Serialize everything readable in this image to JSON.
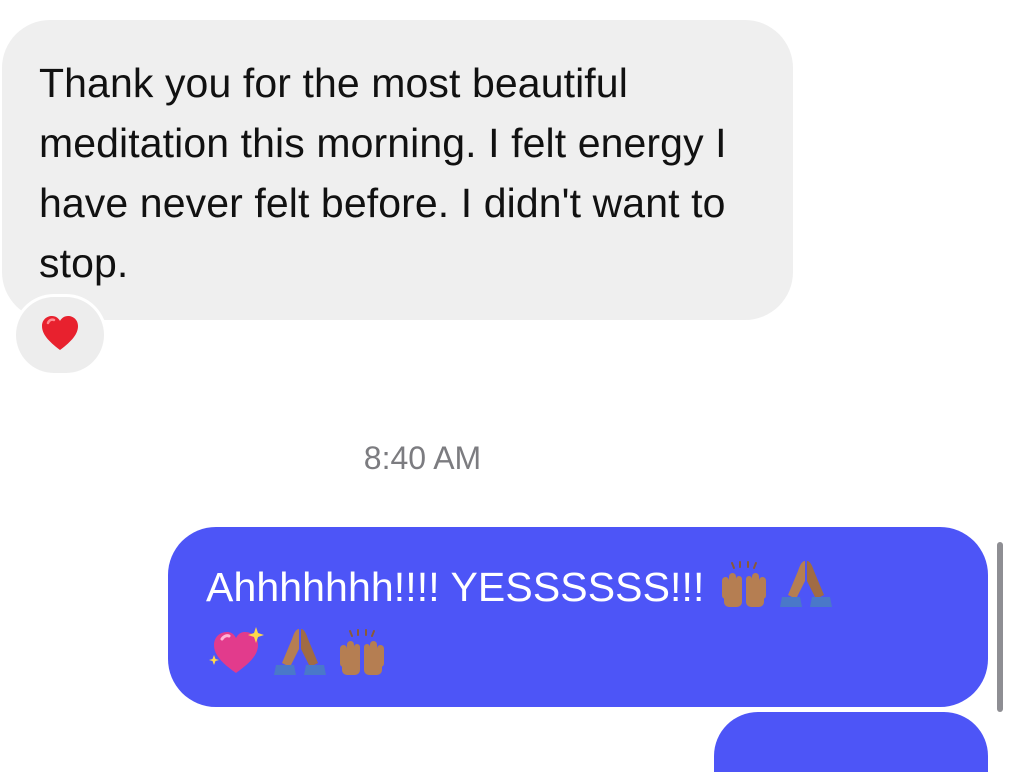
{
  "messages": {
    "incoming": {
      "text": "Thank you for the most beautiful meditation this morning. I felt energy I have never felt before. I didn't want to stop.",
      "reaction_icon": "red-heart"
    },
    "timestamp": "8:40 AM",
    "outgoing": {
      "text": "Ahhhhhhh!!!! YESSSSSS!!! ",
      "emojis": [
        "raising-hands-medium-skin",
        "folded-hands-medium-skin",
        "sparkling-heart",
        "folded-hands-medium-skin",
        "raising-hands-medium-skin"
      ]
    }
  },
  "colors": {
    "incoming_bubble": "#efefef",
    "outgoing_bubble": "#4d55f7",
    "timestamp_text": "#7c7c80",
    "heart": "#e8212e",
    "skin": "#b57e52"
  }
}
